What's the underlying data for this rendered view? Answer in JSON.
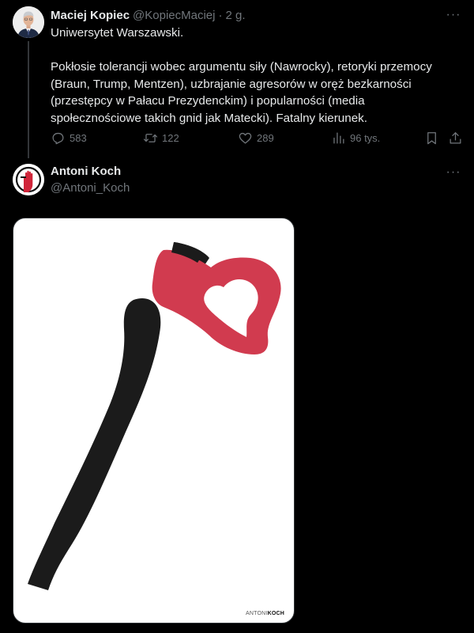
{
  "tweet1": {
    "author_name": "Maciej Kopiec",
    "handle": "@KopiecMaciej",
    "separator": "·",
    "time": "2 g.",
    "more_label": "···",
    "text": "Uniwersytet Warszawski.\n\nPokłosie tolerancji wobec argumentu siły (Nawrocky), retoryki przemocy (Braun, Trump, Mentzen), uzbrajanie agresorów w oręż bezkarności (przestępcy w Pałacu Prezydenckim) i popularności (media społecznościowe takich gnid jak Matecki). Fatalny kierunek.",
    "stats": {
      "replies": "583",
      "retweets": "122",
      "likes": "289",
      "views": "96 tys."
    }
  },
  "tweet2": {
    "author_name": "Antoni Koch",
    "handle": "@Antoni_Koch",
    "more_label": "···",
    "image": {
      "watermark_light": "ANTONI",
      "watermark_bold": "KOCH"
    }
  },
  "colors": {
    "background": "#000000",
    "text_primary": "#e7e9ea",
    "text_secondary": "#71767b",
    "axe_handle": "#1b1b1b",
    "axe_head": "#d13b4f"
  },
  "icons": {
    "reply": "reply-icon",
    "retweet": "retweet-icon",
    "like": "heart-icon",
    "views": "views-icon",
    "bookmark": "bookmark-icon",
    "share": "share-icon"
  }
}
